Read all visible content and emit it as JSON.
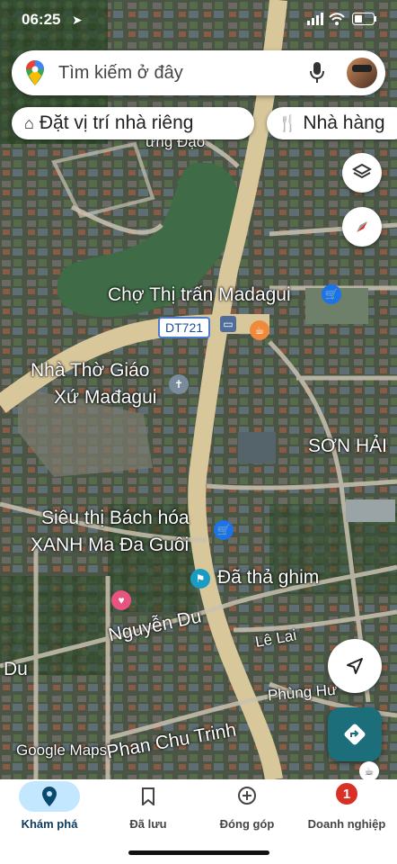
{
  "status_bar": {
    "time": "06:25"
  },
  "search": {
    "placeholder": "Tìm kiếm ở đây"
  },
  "chips": [
    {
      "label": "Đặt vị trí nhà riêng",
      "icon": "home-icon"
    },
    {
      "label": "Nhà hàng",
      "icon": "restaurant-icon"
    }
  ],
  "map_labels": {
    "road_hung_dao": "ưng Đạo",
    "cho": "Chợ Thị trấn Madagui",
    "dt721": "DT721",
    "nha_tho_line1": "Nhà Thờ Giáo",
    "nha_tho_line2": "Xứ Mađagui",
    "son_hai": "SƠN HẢI",
    "sieu_thi_line1": "Siêu thị Bách hóa",
    "sieu_thi_line2": "XANH Ma Đa Guôi",
    "da_tha_ghim": "Đã thả ghim",
    "nguyen_du": "Nguyễn Du",
    "du": "Du",
    "le_lai": "Lê Lai",
    "phung_hung": "Phùng Hư",
    "phan_chu_trinh": "Phan Chu Trinh",
    "google_maps": "Google Maps"
  },
  "bottom_nav": [
    {
      "label": "Khám phá",
      "icon": "explore-pin-icon",
      "active": true
    },
    {
      "label": "Đã lưu",
      "icon": "bookmark-icon",
      "active": false
    },
    {
      "label": "Đóng góp",
      "icon": "add-circle-icon",
      "active": false
    },
    {
      "label": "Doanh nghiệp",
      "icon": "business-icon",
      "active": false,
      "badge": "1"
    }
  ],
  "colors": {
    "accent": "#1a73e8",
    "nav_active_bg": "#c2e7ff",
    "directions_btn": "#1b6e7a",
    "badge": "#d93025"
  }
}
